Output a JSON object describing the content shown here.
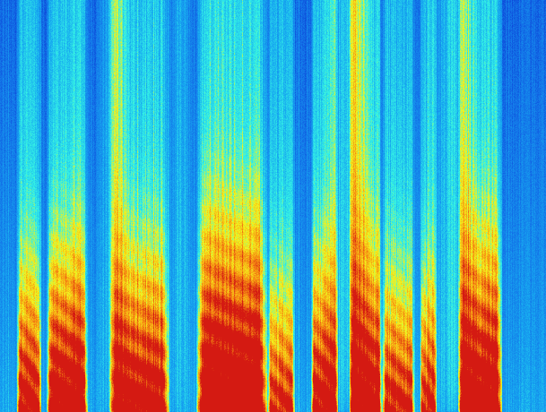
{
  "image": {
    "kind": "spectrogram",
    "colormap": "jet",
    "colors": {
      "low": "#0a2fd0",
      "mid_low": "#17a9f0",
      "mid": "#33f0e6",
      "mid_high": "#f3f31c",
      "high": "#d41a12"
    }
  },
  "spectrogram": {
    "segments": [
      {
        "start": 0.03,
        "end": 0.075,
        "intensity": 0.78
      },
      {
        "start": 0.085,
        "end": 0.16,
        "intensity": 0.9
      },
      {
        "start": 0.2,
        "end": 0.31,
        "intensity": 0.84
      },
      {
        "start": 0.36,
        "end": 0.49,
        "intensity": 1.0
      },
      {
        "start": 0.49,
        "end": 0.54,
        "intensity": 0.68
      },
      {
        "start": 0.57,
        "end": 0.62,
        "intensity": 0.8
      },
      {
        "start": 0.64,
        "end": 0.7,
        "intensity": 0.86
      },
      {
        "start": 0.7,
        "end": 0.76,
        "intensity": 0.72
      },
      {
        "start": 0.77,
        "end": 0.8,
        "intensity": 0.7
      },
      {
        "start": 0.84,
        "end": 0.92,
        "intensity": 0.92
      }
    ],
    "bright_columns": [
      {
        "center": 0.205,
        "width": 0.02,
        "intensity": 0.7
      },
      {
        "center": 0.33,
        "width": 0.02,
        "intensity": 0.55
      },
      {
        "center": 0.64,
        "width": 0.03,
        "intensity": 0.88
      },
      {
        "center": 0.83,
        "width": 0.03,
        "intensity": 0.84
      }
    ]
  }
}
